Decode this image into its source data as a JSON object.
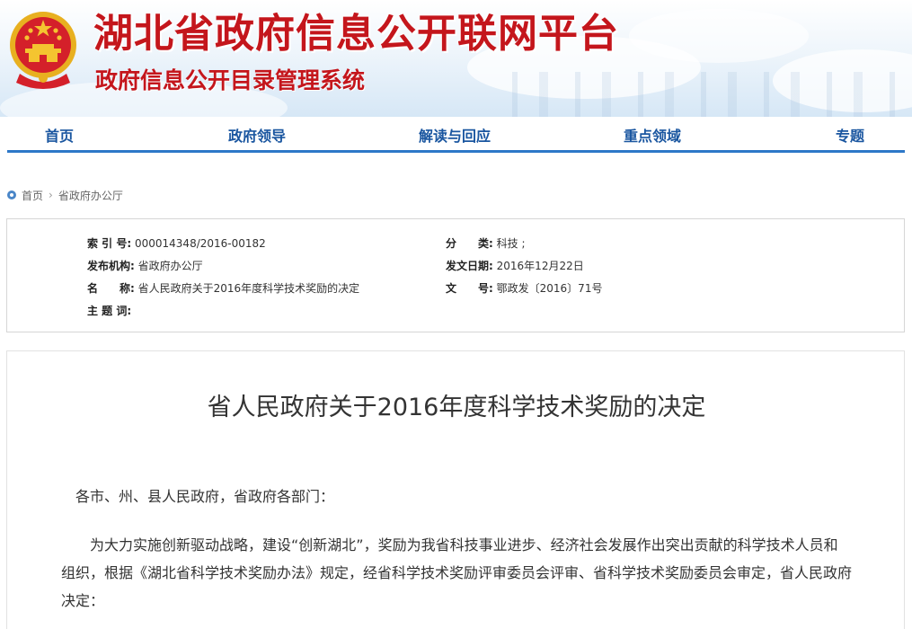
{
  "header": {
    "title": "湖北省政府信息公开联网平台",
    "subtitle": "政府信息公开目录管理系统",
    "emblem_icon": "national-emblem-icon",
    "colors": {
      "title": "#c4161c",
      "nav_text": "#1a56a0",
      "nav_rule": "#2d78c8"
    }
  },
  "nav": {
    "items": [
      "首页",
      "政府领导",
      "解读与回应",
      "重点领域",
      "专题"
    ]
  },
  "breadcrumb": {
    "home": "首页",
    "separator": "›",
    "current": "省政府办公厅"
  },
  "meta": {
    "index_label": "索 引 号:",
    "index_value": "000014348/2016-00182",
    "category_label": "分　　类:",
    "category_value": "科技 ;",
    "publisher_label": "发布机构:",
    "publisher_value": "省政府办公厅",
    "date_label": "发文日期:",
    "date_value": "2016年12月22日",
    "name_label": "名　　称:",
    "name_value": "省人民政府关于2016年度科学技术奖励的决定",
    "docno_label": "文　　号:",
    "docno_value": "鄂政发〔2016〕71号",
    "keywords_label": "主 题 词:",
    "keywords_value": ""
  },
  "article": {
    "title": "省人民政府关于2016年度科学技术奖励的决定",
    "salutation": "各市、州、县人民政府，省政府各部门：",
    "paragraph1": "为大力实施创新驱动战略，建设“创新湖北”，奖励为我省科技事业进步、经济社会发展作出突出贡献的科学技术人员和组织，根据《湖北省科学技术奖励办法》规定，经省科学技术奖励评审委员会评审、省科学技术奖励委员会审定，省人民政府决定："
  }
}
